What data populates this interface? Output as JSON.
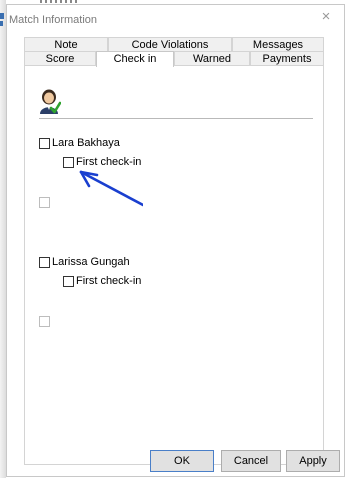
{
  "window": {
    "title": "Match Information",
    "close_glyph": "×"
  },
  "tabs": {
    "back_row": [
      {
        "label": "Note"
      },
      {
        "label": "Code Violations"
      },
      {
        "label": "Messages"
      }
    ],
    "front_row": [
      {
        "label": "Score"
      },
      {
        "label": "Check in",
        "active": true
      },
      {
        "label": "Warned"
      },
      {
        "label": "Payments"
      }
    ]
  },
  "check_in": {
    "header_icon": "user-check-icon",
    "players": [
      {
        "name": "Lara Bakhaya",
        "first_checkin_label": "First check-in",
        "checked": false
      },
      {
        "name": "Larissa Gungah",
        "first_checkin_label": "First check-in",
        "checked": false
      }
    ]
  },
  "buttons": {
    "ok": "OK",
    "cancel": "Cancel",
    "apply": "Apply"
  },
  "colors": {
    "arrow": "#1a3fcf",
    "default_button_border": "#4a7fc8"
  }
}
